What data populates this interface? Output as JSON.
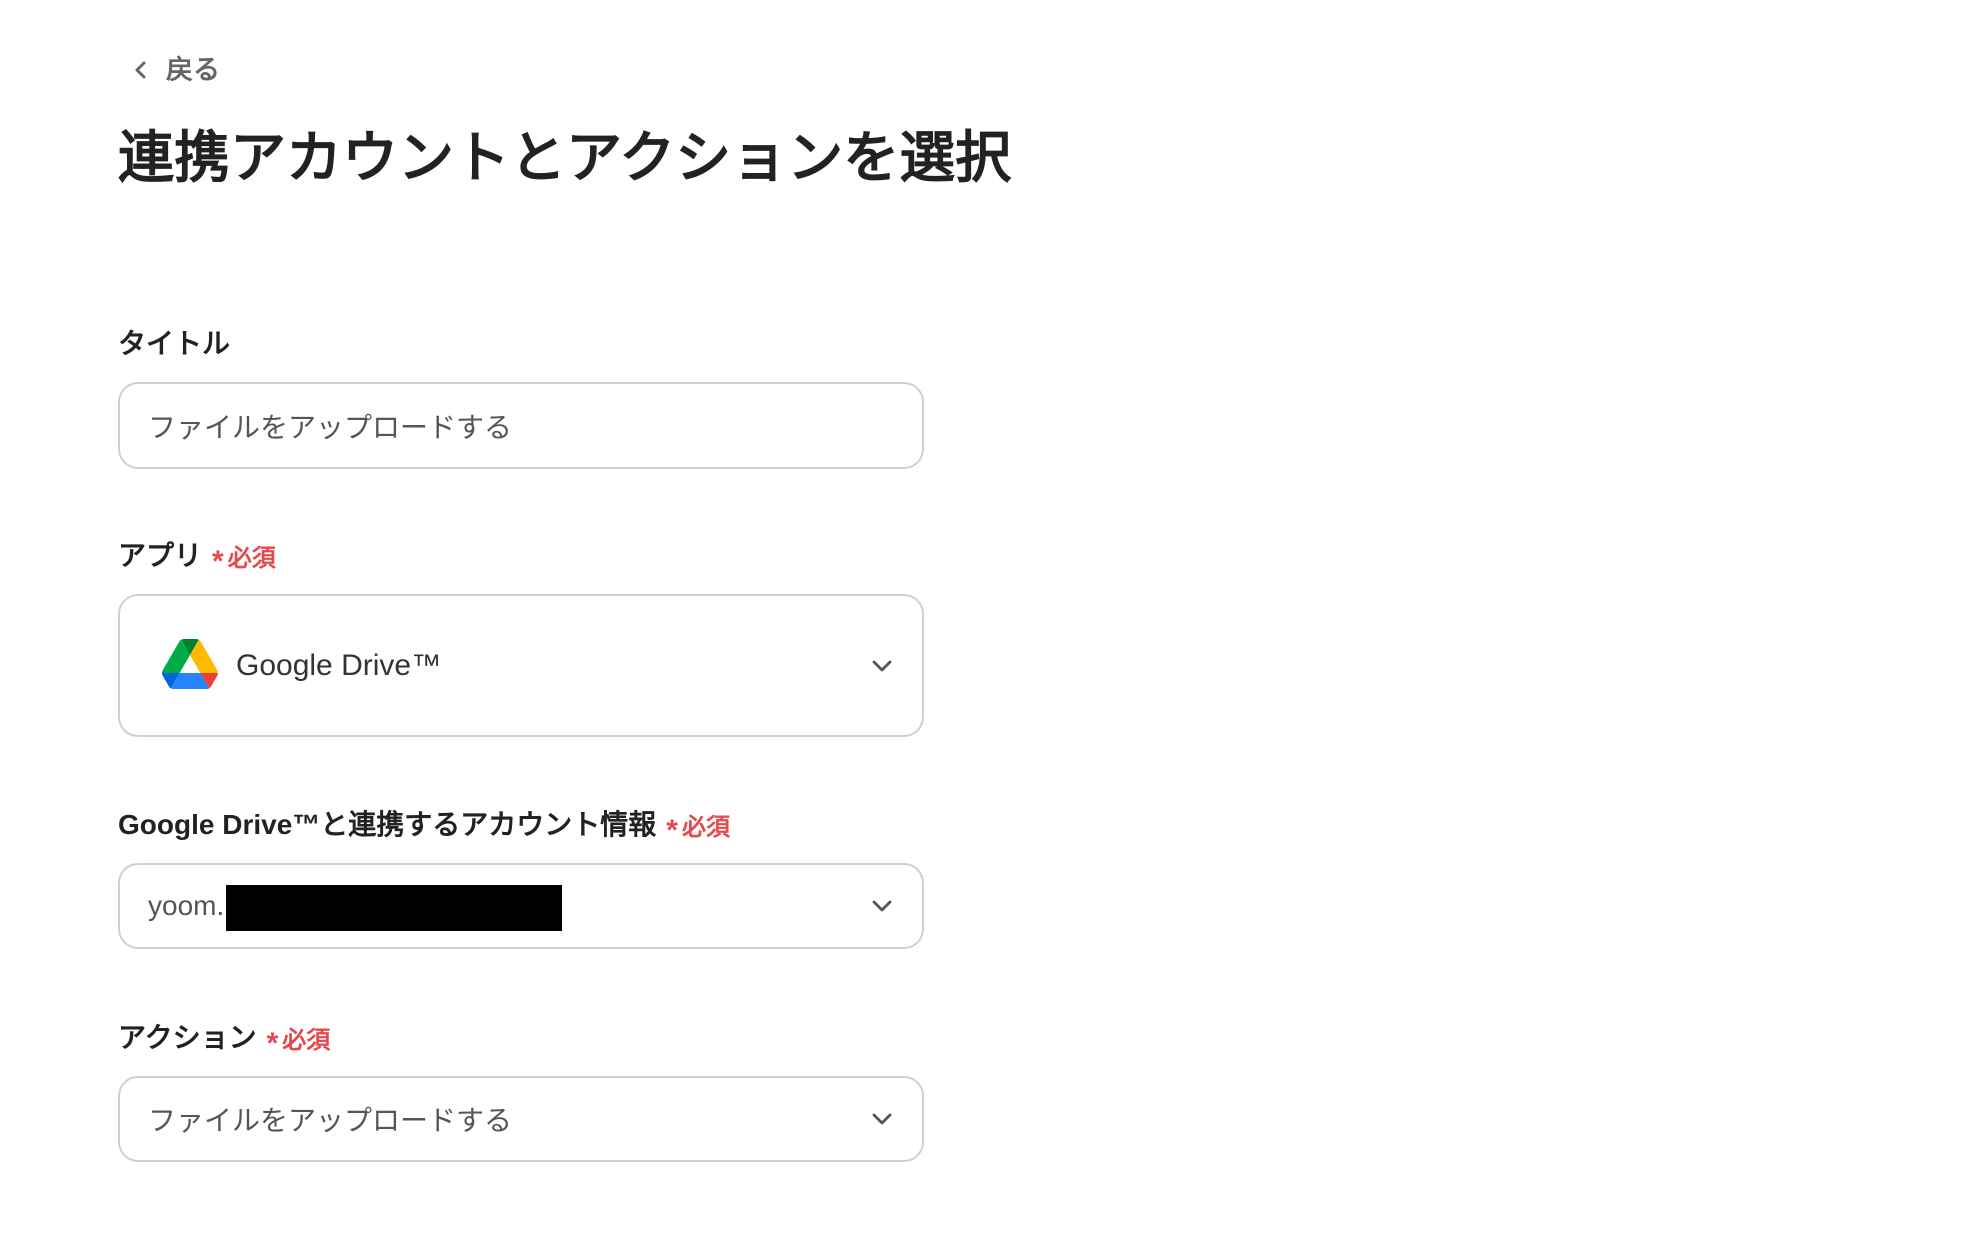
{
  "back": {
    "label": "戻る",
    "icon": "chevron-left-icon"
  },
  "page_title": "連携アカウントとアクションを選択",
  "fields": {
    "title": {
      "label": "タイトル",
      "value": "ファイルをアップロードする"
    },
    "app": {
      "label": "アプリ",
      "required_mark": "*",
      "required_text": "必須",
      "value": "Google Drive™",
      "icon": "google-drive-icon",
      "dropdown_icon": "chevron-down-icon"
    },
    "account": {
      "label": "Google Drive™と連携するアカウント情報",
      "required_mark": "*",
      "required_text": "必須",
      "value": "yoom.",
      "dropdown_icon": "chevron-down-icon"
    },
    "action": {
      "label": "アクション",
      "required_mark": "*",
      "required_text": "必須",
      "value": "ファイルをアップロードする",
      "dropdown_icon": "chevron-down-icon"
    }
  },
  "colors": {
    "text": "#222222",
    "muted": "#666666",
    "input_text": "#555555",
    "border": "#d0d0d0",
    "required": "#e5484d",
    "background": "#ffffff",
    "redaction": "#000000"
  }
}
